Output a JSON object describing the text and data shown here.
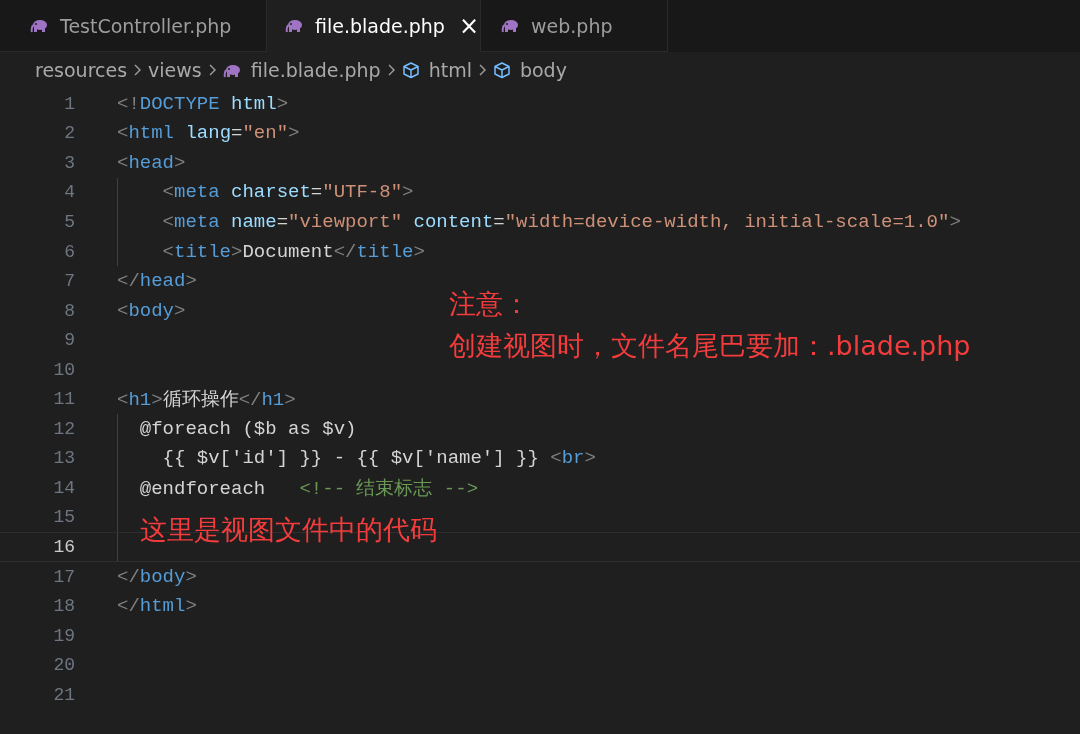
{
  "tabs": [
    {
      "label": "TestController.php",
      "selected": false
    },
    {
      "label": "file.blade.php",
      "selected": true,
      "close": "×"
    },
    {
      "label": "web.php",
      "selected": false
    }
  ],
  "breadcrumb": [
    {
      "label": "resources",
      "kind": "folder"
    },
    {
      "label": "views",
      "kind": "folder"
    },
    {
      "label": "file.blade.php",
      "kind": "file"
    },
    {
      "label": "html",
      "kind": "symbol"
    },
    {
      "label": "body",
      "kind": "symbol"
    }
  ],
  "lines": [
    {
      "number": "1",
      "current": false,
      "guide": false,
      "code": "<!DOCTYPE html>"
    },
    {
      "number": "2",
      "current": false,
      "guide": false,
      "code": "<html lang=\"en\">"
    },
    {
      "number": "3",
      "current": false,
      "guide": false,
      "code": "<head>"
    },
    {
      "number": "4",
      "current": false,
      "guide": true,
      "code": "    <meta charset=\"UTF-8\">"
    },
    {
      "number": "5",
      "current": false,
      "guide": true,
      "code": "    <meta name=\"viewport\" content=\"width=device-width, initial-scale=1.0\">"
    },
    {
      "number": "6",
      "current": false,
      "guide": true,
      "code": "    <title>Document</title>"
    },
    {
      "number": "7",
      "current": false,
      "guide": false,
      "code": "</head>"
    },
    {
      "number": "8",
      "current": false,
      "guide": false,
      "code": "<body>"
    },
    {
      "number": "9",
      "current": false,
      "guide": false
    },
    {
      "number": "10",
      "current": false,
      "guide": false
    },
    {
      "number": "11",
      "current": false,
      "guide": false,
      "code": "<h1>循环操作</h1>"
    },
    {
      "number": "12",
      "current": false,
      "guide": true,
      "code": "  @foreach ($b as $v)"
    },
    {
      "number": "13",
      "current": false,
      "guide": true,
      "code": "    {{ $v['id'] }} - {{ $v['name'] }} <br>"
    },
    {
      "number": "14",
      "current": false,
      "guide": true,
      "code": "  @endforeach   <!-- 结束标志 -->"
    },
    {
      "number": "15",
      "current": false,
      "guide": true
    },
    {
      "number": "16",
      "current": true,
      "guide": true
    },
    {
      "number": "17",
      "current": false,
      "guide": false,
      "code": "</body>"
    },
    {
      "number": "18",
      "current": false,
      "guide": false,
      "code": "</html>"
    },
    {
      "number": "19",
      "current": false,
      "guide": false
    },
    {
      "number": "20",
      "current": false,
      "guide": false
    },
    {
      "number": "21",
      "current": false,
      "guide": false
    }
  ],
  "annotations": [
    {
      "text": "注意：",
      "kind": "heading"
    },
    {
      "text": "创建视图时，文件名尾巴要加：.blade.php",
      "kind": "note"
    },
    {
      "text": "这里是视图文件中的代码",
      "kind": "caption"
    }
  ]
}
